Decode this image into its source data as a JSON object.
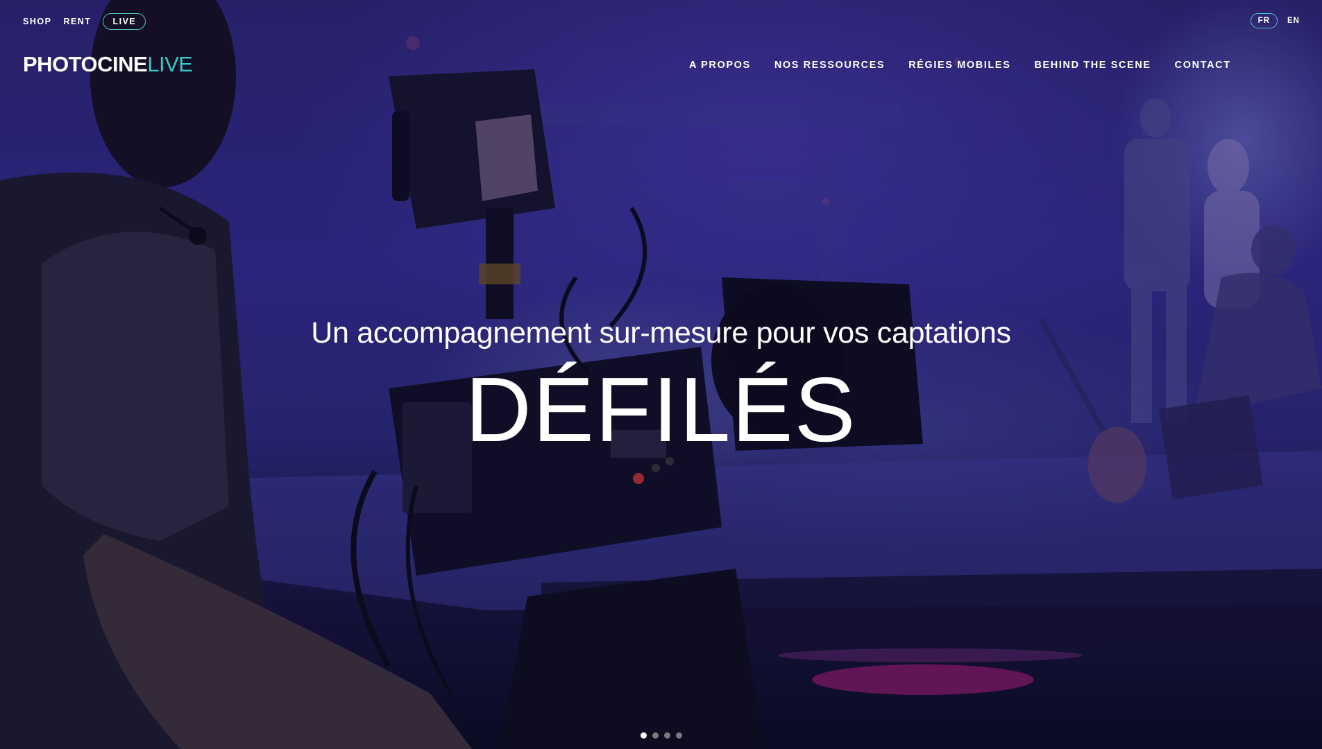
{
  "util_nav": {
    "shop": "SHOP",
    "rent": "RENT",
    "live": "LIVE"
  },
  "lang": {
    "fr": "FR",
    "en": "EN"
  },
  "logo": {
    "strong": "PHOTOCINE",
    "light": "LIVE"
  },
  "main_nav": {
    "items": [
      "A PROPOS",
      "NOS RESSOURCES",
      "RÉGIES MOBILES",
      "BEHIND THE SCENE",
      "CONTACT"
    ]
  },
  "hero": {
    "tagline": "Un accompagnement sur-mesure pour vos captations",
    "headline": "DÉFILÉS"
  },
  "slider": {
    "count": 4,
    "active_index": 0
  },
  "colors": {
    "accent": "#36c9c6",
    "hero_tint": "#2f2a86"
  }
}
